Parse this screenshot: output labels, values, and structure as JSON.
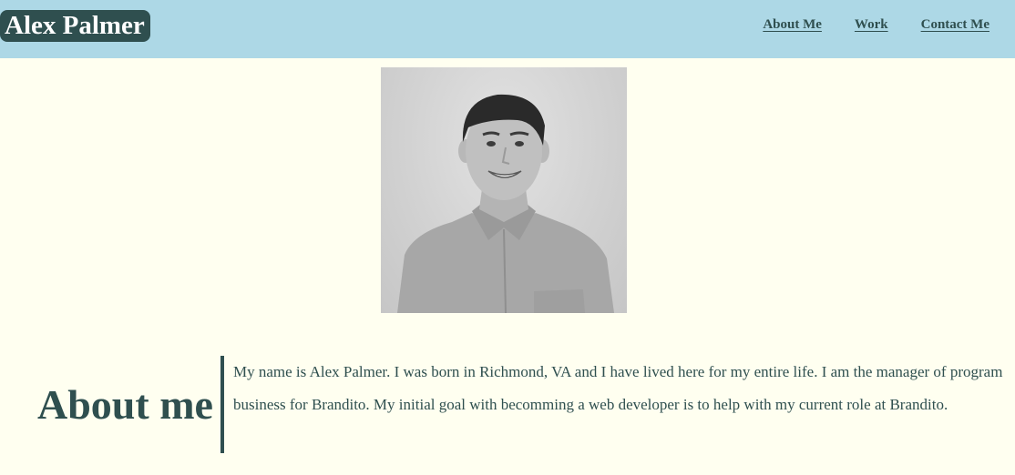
{
  "header": {
    "logo_text": "Alex Palmer",
    "nav": [
      {
        "label": "About Me"
      },
      {
        "label": "Work"
      },
      {
        "label": "Contact Me"
      }
    ]
  },
  "profile": {
    "photo": "portrait-photo"
  },
  "about": {
    "heading": "About me",
    "body": "My name is Alex Palmer. I was born in Richmond, VA and I have lived here for my entire life. I am the manager of program business for Brandito. My initial goal with becomming a web developer is to help with my current role at Brandito."
  },
  "colors": {
    "header_bg": "#add8e6",
    "page_bg": "#fffff0",
    "accent": "#2f4f4f",
    "logo_text": "#ffffff"
  }
}
